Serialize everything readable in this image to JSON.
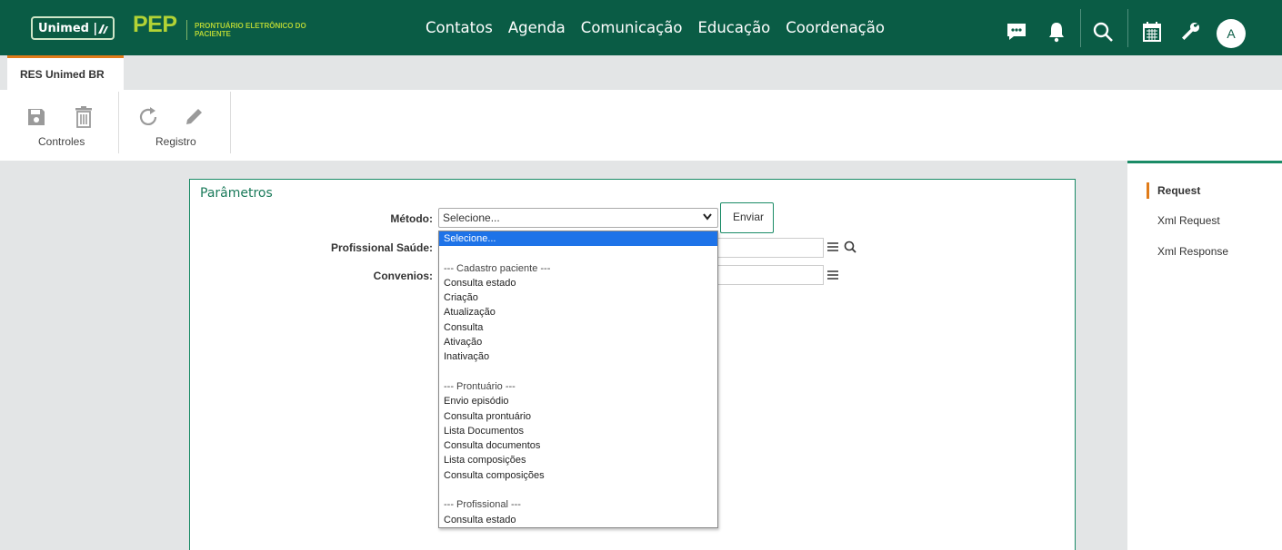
{
  "header": {
    "logo_text": "Unimed",
    "app_name": "PEP",
    "app_subtitle": "PRONTUÁRIO ELETRÔNICO DO PACIENTE",
    "nav": [
      "Contatos",
      "Agenda",
      "Comunicação",
      "Educação",
      "Coordenação"
    ],
    "avatar_initial": "A",
    "icons": [
      "chat-icon",
      "bell-icon",
      "search-icon",
      "calendar-icon",
      "wrench-icon"
    ]
  },
  "tabs": [
    {
      "label": "RES Unimed BR",
      "active": true
    }
  ],
  "toolbar": {
    "groups": [
      {
        "label": "Controles",
        "buttons": [
          "save-icon",
          "trash-icon"
        ]
      },
      {
        "label": "Registro",
        "buttons": [
          "refresh-icon",
          "pencil-icon"
        ]
      }
    ]
  },
  "form": {
    "title": "Parâmetros",
    "metodo_label": "Método:",
    "metodo_value": "Selecione...",
    "enviar_label": "Enviar",
    "profissional_label": "Profissional Saúde:",
    "convenios_label": "Convenios:",
    "dropdown_options": [
      {
        "text": "Selecione...",
        "kind": "selected"
      },
      {
        "text": "",
        "kind": "blank"
      },
      {
        "text": "--- Cadastro paciente ---",
        "kind": "group"
      },
      {
        "text": "Consulta estado",
        "kind": "option"
      },
      {
        "text": "Criação",
        "kind": "option"
      },
      {
        "text": "Atualização",
        "kind": "option"
      },
      {
        "text": "Consulta",
        "kind": "option"
      },
      {
        "text": "Ativação",
        "kind": "option"
      },
      {
        "text": "Inativação",
        "kind": "option"
      },
      {
        "text": "",
        "kind": "blank"
      },
      {
        "text": "--- Prontuário ---",
        "kind": "group"
      },
      {
        "text": "Envio episódio",
        "kind": "option"
      },
      {
        "text": "Consulta prontuário",
        "kind": "option"
      },
      {
        "text": "Lista Documentos",
        "kind": "option"
      },
      {
        "text": "Consulta documentos",
        "kind": "option"
      },
      {
        "text": "Lista composições",
        "kind": "option"
      },
      {
        "text": "Consulta composições",
        "kind": "option"
      },
      {
        "text": "",
        "kind": "blank"
      },
      {
        "text": "--- Profissional ---",
        "kind": "group"
      },
      {
        "text": "Consulta estado",
        "kind": "option"
      }
    ]
  },
  "sidebar": {
    "items": [
      {
        "label": "Request",
        "active": true
      },
      {
        "label": "Xml Request",
        "active": false
      },
      {
        "label": "Xml Response",
        "active": false
      }
    ]
  },
  "colors": {
    "brand": "#0a5c45",
    "accent": "#b3d335",
    "tab_accent": "#e07b19",
    "border_green": "#1a8b66",
    "selected_option": "#1e73e8"
  }
}
